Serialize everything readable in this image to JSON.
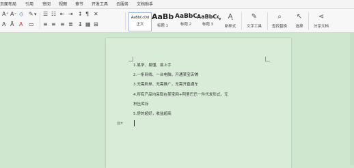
{
  "ribbon": {
    "tabs": [
      "页面布局",
      "引用",
      "审阅",
      "视图",
      "章节",
      "开发工具",
      "云服务",
      "文档助手"
    ]
  },
  "toolbar": {
    "styles": [
      {
        "preview": "AaBbCcDd",
        "label": "正文"
      },
      {
        "preview": "AaBb",
        "label": "标题 1"
      },
      {
        "preview": "AaBbC",
        "label": "标题 2"
      },
      {
        "preview": "AaBbCc",
        "label": "标题 3"
      }
    ],
    "tools": [
      {
        "icon": "new-style-icon",
        "label": "新样式"
      },
      {
        "icon": "text-tools-icon",
        "label": "文字工具"
      },
      {
        "icon": "find-replace-icon",
        "label": "查找替换"
      },
      {
        "icon": "select-icon",
        "label": "选择"
      },
      {
        "icon": "share-icon",
        "label": "分享文档"
      }
    ]
  },
  "document": {
    "lines": [
      "1.易学、易懂、易上手",
      "2.一条网线、一台电脑，开通某宝店铺",
      "3.无需刷单、无需推广，无需开直通车",
      "4.所有产品均采取在某宝网+阿里巴巴一件代发形式，无",
      "积压库存",
      "5.房的超好，收益超高"
    ]
  }
}
